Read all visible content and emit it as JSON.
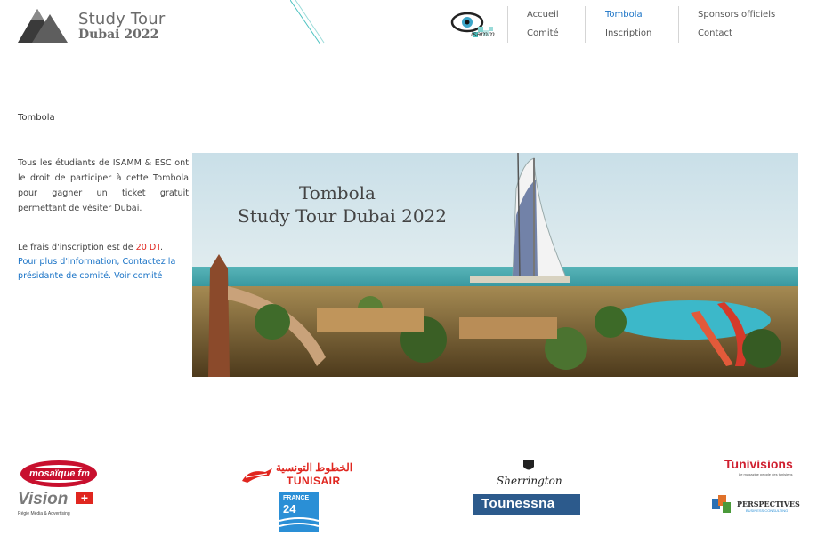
{
  "site": {
    "logo_title": "Study Tour",
    "logo_subtitle": "Dubai 2022",
    "isamm_label": "isamm"
  },
  "nav": {
    "col1": [
      "Accueil",
      "Comité"
    ],
    "col2": [
      "Tombola",
      "Inscription"
    ],
    "col3": [
      "Sponsors officiels",
      "Contact"
    ],
    "active": "Tombola"
  },
  "breadcrumb": "Tombola",
  "content": {
    "intro": "Tous les étudiants de ISAMM & ESC ont le droit de participer à cette Tombola pour gagner un ticket gratuit permettant de vésiter Dubai.",
    "fee_prefix": "Le frais d'inscription est de ",
    "fee_amount": "20 DT",
    "fee_suffix": ".",
    "info_link": "Pour plus d'information, Contactez la présidante de comité.",
    "voir_link": "Voir comité"
  },
  "banner": {
    "line1": "Tombola",
    "line2": "Study Tour Dubai 2022"
  },
  "sponsors": {
    "mosaique": "mosaïque fm",
    "vision": "Vision",
    "vision_tag": "Régie Média & Advertising",
    "tunisair_ar": "الخطوط التونسية",
    "tunisair": "TUNISAIR",
    "france24_a": "FRANCE",
    "france24_b": "24",
    "sherrington": "Sherrington",
    "tounessna": "Tounessna",
    "tunivisions": "Tunivisions",
    "tunivisions_tag": "Le magazine people des tunisiens",
    "perspectives": "PERSPECTIVES",
    "perspectives_tag": "BUSINESS CONSULTING"
  },
  "colors": {
    "accent": "#1a73c6",
    "price_red": "#e0261f",
    "tounessna_blue": "#2c5a8c",
    "mosaique_red": "#c8102e"
  }
}
